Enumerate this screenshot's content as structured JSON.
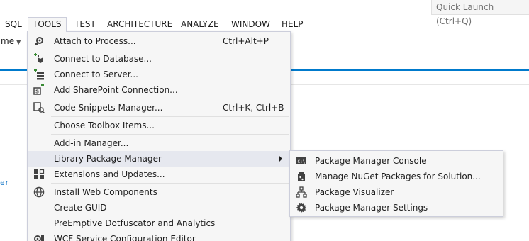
{
  "quick_launch": {
    "text": "Quick Launch (Ctrl+Q)"
  },
  "menubar": {
    "items": [
      "SQL",
      "TOOLS",
      "TEST",
      "ARCHITECTURE",
      "ANALYZE",
      "WINDOW",
      "HELP"
    ],
    "active": "TOOLS"
  },
  "toolbar": {
    "fragment": "me"
  },
  "background": {
    "link_fragment": "er"
  },
  "tools_menu": {
    "items": [
      {
        "label": "Attach to Process...",
        "shortcut": "Ctrl+Alt+P",
        "icon": "attach-process-icon"
      },
      {
        "label": "Connect to Database...",
        "icon": "connect-database-icon"
      },
      {
        "label": "Connect to Server...",
        "icon": "connect-server-icon"
      },
      {
        "label": "Add SharePoint Connection...",
        "icon": "sharepoint-icon"
      },
      {
        "label": "Code Snippets Manager...",
        "shortcut": "Ctrl+K, Ctrl+B",
        "icon": "snippets-icon"
      },
      {
        "label": "Choose Toolbox Items..."
      },
      {
        "label": "Add-in Manager..."
      },
      {
        "label": "Library Package Manager",
        "has_submenu": true
      },
      {
        "label": "Extensions and Updates...",
        "icon": "extensions-icon"
      },
      {
        "label": "Install Web Components",
        "icon": "web-components-icon"
      },
      {
        "label": "Create GUID"
      },
      {
        "label": "PreEmptive Dotfuscator and Analytics"
      },
      {
        "label": "WCF Service Configuration Editor",
        "icon": "wcf-icon"
      }
    ]
  },
  "package_submenu": {
    "items": [
      {
        "label": "Package Manager Console",
        "icon": "console-icon"
      },
      {
        "label": "Manage NuGet Packages for Solution...",
        "icon": "nuget-icon"
      },
      {
        "label": "Package Visualizer",
        "icon": "hierarchy-icon"
      },
      {
        "label": "Package Manager Settings",
        "icon": "gear-icon"
      }
    ]
  },
  "colors": {
    "accent": "#007acc",
    "menu_bg": "#f6f6f6",
    "highlight": "#e6e8ef",
    "border": "#cccedb"
  }
}
